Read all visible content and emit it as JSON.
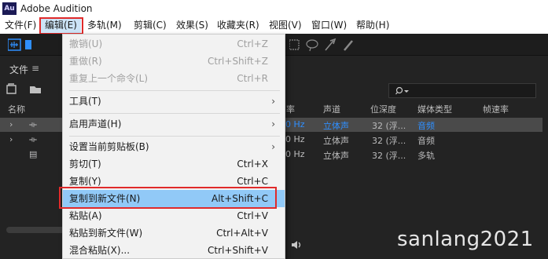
{
  "app": {
    "logo": "Au",
    "title": "Adobe Audition"
  },
  "menubar": [
    {
      "label": "文件(F)",
      "active": false
    },
    {
      "label": "编辑(E)",
      "active": true
    },
    {
      "label": "多轨(M)",
      "active": false
    },
    {
      "label": "剪辑(C)",
      "active": false
    },
    {
      "label": "效果(S)",
      "active": false
    },
    {
      "label": "收藏夹(R)",
      "active": false
    },
    {
      "label": "视图(V)",
      "active": false
    },
    {
      "label": "窗口(W)",
      "active": false
    },
    {
      "label": "帮助(H)",
      "active": false
    }
  ],
  "panel": {
    "tab_label": "文件",
    "menu_icon": "≡",
    "search_icon": "magnifier-dropdown-icon",
    "columns": [
      "名称",
      "率",
      "声道",
      "位深度",
      "媒体类型",
      "帧速率"
    ],
    "rows": [
      {
        "rate": "0 Hz",
        "channels": "立体声",
        "bit_depth": "32 (浮...",
        "media": "音频",
        "selected": true
      },
      {
        "rate": "0 Hz",
        "channels": "立体声",
        "bit_depth": "32 (浮...",
        "media": "音频",
        "selected": false
      },
      {
        "rate": "0 Hz",
        "channels": "立体声",
        "bit_depth": "32 (浮...",
        "media": "多轨",
        "selected": false
      }
    ]
  },
  "edit_menu": {
    "items": [
      {
        "label": "撤销(U)",
        "shortcut": "Ctrl+Z",
        "disabled": true
      },
      {
        "label": "重做(R)",
        "shortcut": "Ctrl+Shift+Z",
        "disabled": true
      },
      {
        "label": "重复上一个命令(L)",
        "shortcut": "Ctrl+R",
        "disabled": true
      },
      {
        "label": "工具(T)",
        "shortcut": "",
        "submenu": true
      },
      {
        "label": "启用声道(H)",
        "shortcut": "",
        "submenu": true
      },
      {
        "label": "设置当前剪贴板(B)",
        "shortcut": "",
        "submenu": true
      },
      {
        "label": "剪切(T)",
        "shortcut": "Ctrl+X"
      },
      {
        "label": "复制(Y)",
        "shortcut": "Ctrl+C"
      },
      {
        "label": "复制到新文件(N)",
        "shortcut": "Alt+Shift+C",
        "highlighted": true
      },
      {
        "label": "粘贴(A)",
        "shortcut": "Ctrl+V"
      },
      {
        "label": "粘贴到新文件(W)",
        "shortcut": "Ctrl+Alt+V"
      },
      {
        "label": "混合粘贴(X)...",
        "shortcut": "Ctrl+Shift+V"
      }
    ]
  },
  "watermark": "sanlang2021",
  "colors": {
    "highlight_box": "#e02a2a",
    "menu_highlight": "#91c9f7",
    "blue_text": "#2f8fff"
  }
}
